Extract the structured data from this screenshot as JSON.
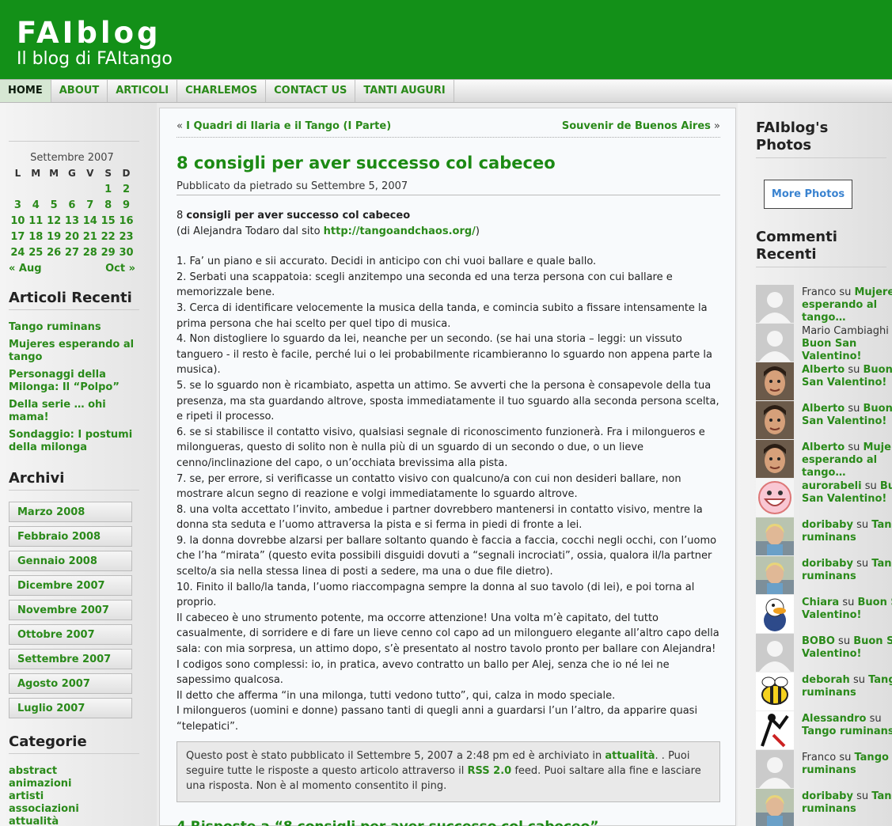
{
  "header": {
    "title": "FAIblog",
    "tagline": "Il blog di FAItango"
  },
  "nav": {
    "items": [
      "HOME",
      "ABOUT",
      "ARTICOLI",
      "CHARLEMOS",
      "CONTACT US",
      "TANTI AUGURI"
    ],
    "active": "HOME"
  },
  "calendar": {
    "caption": "Settembre 2007",
    "days": [
      "L",
      "M",
      "M",
      "G",
      "V",
      "S",
      "D"
    ],
    "weeks": [
      [
        "",
        "",
        "",
        "",
        "",
        "1",
        "2"
      ],
      [
        "3",
        "4",
        "5",
        "6",
        "7",
        "8",
        "9"
      ],
      [
        "10",
        "11",
        "12",
        "13",
        "14",
        "15",
        "16"
      ],
      [
        "17",
        "18",
        "19",
        "20",
        "21",
        "22",
        "23"
      ],
      [
        "24",
        "25",
        "26",
        "27",
        "28",
        "29",
        "30"
      ]
    ],
    "prev": "« Aug",
    "next": "Oct »"
  },
  "recent_posts": {
    "heading": "Articoli Recenti",
    "items": [
      "Tango ruminans",
      "Mujeres esperando al tango",
      "Personaggi della Milonga: Il “Polpo”",
      "Della serie … ohi mama!",
      "Sondaggio: I postumi della milonga"
    ]
  },
  "archives": {
    "heading": "Archivi",
    "items": [
      "Marzo 2008",
      "Febbraio 2008",
      "Gennaio 2008",
      "Dicembre 2007",
      "Novembre 2007",
      "Ottobre 2007",
      "Settembre 2007",
      "Agosto 2007",
      "Luglio 2007"
    ]
  },
  "categories": {
    "heading": "Categorie",
    "items": [
      "abstract",
      "animazioni",
      "artisti",
      "associazioni",
      "attualità"
    ]
  },
  "post": {
    "prev_link": "I Quadri di Ilaria e il Tango (I Parte)",
    "next_link": "Souvenir de Buenos Aires",
    "title": "8 consigli per aver successo col cabeceo",
    "meta": "Pubblicato da pietrado su Settembre 5, 2007",
    "intro_num": "8 ",
    "intro_bold": "consigli per aver successo col cabeceo",
    "intro_source_pre": "(di Alejandra Todaro dal sito ",
    "intro_source_link": "http://tangoandchaos.org/",
    "intro_source_post": ")",
    "paragraphs": [
      "1. Fa’ un piano e sii accurato. Decidi in anticipo con chi vuoi ballare e quale ballo.",
      "2. Serbati una scappatoia: scegli anzitempo una seconda ed una terza persona con cui ballare e memorizzale bene.",
      "3. Cerca di identificare velocemente la musica della tanda, e comincia subito a fissare intensamente la prima persona che hai scelto per quel tipo di musica.",
      "4. Non distogliere lo sguardo da lei, neanche per un secondo. (se hai una storia – leggi: un vissuto tanguero - il resto è facile, perché lui o lei probabilmente ricambieranno lo sguardo non appena parte la musica).",
      "5. se lo sguardo non è ricambiato, aspetta un attimo. Se avverti che la persona è consapevole della tua presenza, ma sta guardando altrove, sposta immediatamente il tuo sguardo alla seconda persona scelta, e ripeti il processo.",
      "6. se si stabilisce il contatto visivo, qualsiasi segnale di riconoscimento funzionerà. Fra i milongueros e milongueras, questo di solito non è nulla più di un sguardo di un secondo o due, o un lieve cenno/inclinazione del capo, o un’occhiata brevissima alla pista.",
      "7. se, per errore, si verificasse un contatto visivo con qualcuno/a con cui non desideri ballare, non mostrare alcun segno di reazione e volgi immediatamente lo sguardo altrove.",
      "8. una volta accettato l’invito, ambedue i partner dovrebbero mantenersi in contatto visivo, mentre la donna sta seduta e l’uomo attraversa la pista e si ferma in piedi di fronte a lei.",
      "9. la donna dovrebbe alzarsi per ballare soltanto quando è faccia a faccia, cocchi negli occhi, con l’uomo che l’ha “mirata” (questo evita possibili disguidi dovuti a “segnali incrociati”, ossia, qualora il/la partner scelto/a sia nella stessa linea di posti a sedere, ma una o due file dietro).",
      "10. Finito il ballo/la tanda, l’uomo riaccompagna sempre la donna al suo tavolo (di lei), e poi torna al proprio.",
      "Il cabeceo è uno strumento potente, ma occorre attenzione! Una volta m’è capitato, del tutto casualmente, di sorridere e di fare un lieve cenno col capo ad un milonguero elegante all’altro capo della sala: con mia sorpresa, un attimo dopo, s’è presentato al nostro tavolo pronto per ballare con Alejandra! I codigos sono complessi: io, in pratica, avevo contratto un ballo per Alej, senza che io né lei ne sapessimo qualcosa.",
      "Il detto che afferma “in una milonga, tutti vedono tutto”, qui, calza in modo speciale.",
      "I milongueros (uomini e donne) passano tanti di quegli anni a guardarsi l’un l’altro, da apparire quasi “telepatici”."
    ],
    "info_pre": "Questo post è stato pubblicato il Settembre 5, 2007 a 2:48 pm ed è archiviato in ",
    "info_cat": "attualità",
    "info_mid": ". . Puoi seguire tutte le risposte a questo articolo attraverso il ",
    "info_rss": "RSS 2.0",
    "info_post": " feed. Puoi saltare alla fine e lasciare una risposta. Non è al momento consentito il ping.",
    "next_title_cut": "4 Risposte a “8 consigli per aver successo col cabeceo”"
  },
  "photos": {
    "heading": "FAIblog's Photos",
    "button": "More Photos"
  },
  "recent_comments": {
    "heading": "Commenti Recenti",
    "items": [
      {
        "author": "Franco",
        "author_link": false,
        "on": " su ",
        "post": "Mujeres esperando al tango…",
        "avatar": "default"
      },
      {
        "author": "Mario Cambiaghi",
        "author_link": false,
        "on": " su ",
        "post": "Buon San Valentino!",
        "avatar": "default"
      },
      {
        "author": "Alberto",
        "author_link": true,
        "on": " su ",
        "post": "Buon San Valentino!",
        "avatar": "face"
      },
      {
        "author": "Alberto",
        "author_link": true,
        "on": " su ",
        "post": "Buon San Valentino!",
        "avatar": "face"
      },
      {
        "author": "Alberto",
        "author_link": true,
        "on": " su ",
        "post": "Mujeres esperando al tango…",
        "avatar": "face"
      },
      {
        "author": "aurorabeli",
        "author_link": true,
        "on": " su ",
        "post": "Buon San Valentino!",
        "avatar": "smiley"
      },
      {
        "author": "doribaby",
        "author_link": true,
        "on": " su ",
        "post": "Tango ruminans",
        "avatar": "photo"
      },
      {
        "author": "doribaby",
        "author_link": true,
        "on": " su ",
        "post": "Tango ruminans",
        "avatar": "photo"
      },
      {
        "author": "Chiara",
        "author_link": true,
        "on": " su ",
        "post": "Buon San Valentino!",
        "avatar": "duck"
      },
      {
        "author": "BOBO",
        "author_link": true,
        "on": " su ",
        "post": "Buon San Valentino!",
        "avatar": "default"
      },
      {
        "author": "deborah",
        "author_link": true,
        "on": " su ",
        "post": "Tango ruminans",
        "avatar": "bee"
      },
      {
        "author": "Alessandro",
        "author_link": true,
        "on": " su ",
        "post": "Tango ruminans",
        "avatar": "dancer"
      },
      {
        "author": "Franco",
        "author_link": false,
        "on": " su ",
        "post": "Tango ruminans",
        "avatar": "default"
      },
      {
        "author": "doribaby",
        "author_link": true,
        "on": " su ",
        "post": "Tango ruminans",
        "avatar": "photo"
      }
    ]
  }
}
